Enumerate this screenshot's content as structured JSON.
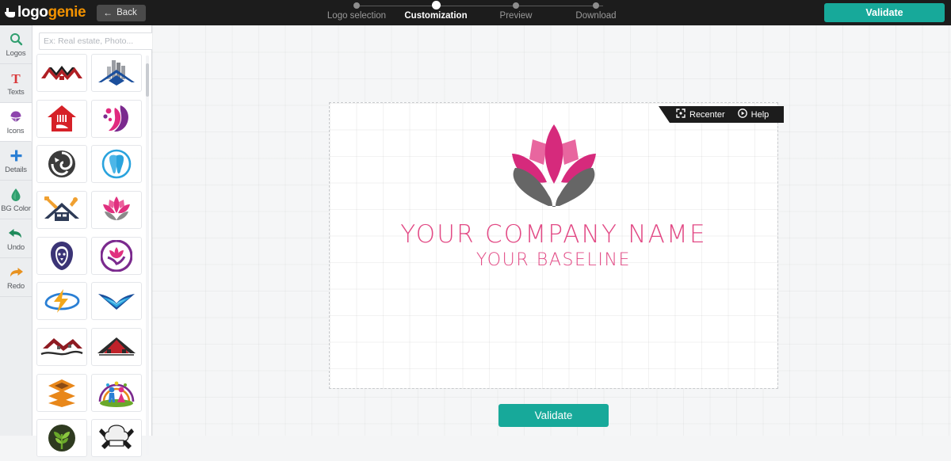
{
  "brand": {
    "part1": "logo",
    "part2": "genie",
    "icon": "lamp-icon"
  },
  "topbar": {
    "back_label": "Back",
    "back_icon": "arrow-left-icon",
    "validate_label": "Validate"
  },
  "steps": [
    {
      "label": "Logo selection",
      "active": false
    },
    {
      "label": "Customization",
      "active": true
    },
    {
      "label": "Preview",
      "active": false
    },
    {
      "label": "Download",
      "active": false
    }
  ],
  "rail": [
    {
      "label": "Logos",
      "icon": "search-icon",
      "color": "#2f9e6e",
      "selected": false
    },
    {
      "label": "Texts",
      "icon": "text-t-icon",
      "color": "#d9383a",
      "selected": false
    },
    {
      "label": "Icons",
      "icon": "shapes-icon",
      "color": "#8e44ad",
      "selected": true
    },
    {
      "label": "Details",
      "icon": "plus-icon",
      "color": "#2a7fd4",
      "selected": false
    },
    {
      "label": "BG Color",
      "icon": "droplet-icon",
      "color": "#2f9e6e",
      "selected": false
    },
    {
      "label": "Undo",
      "icon": "undo-arrow-icon",
      "color": "#1f8a5b",
      "selected": false
    },
    {
      "label": "Redo",
      "icon": "redo-arrow-icon",
      "color": "#e8921f",
      "selected": false
    }
  ],
  "search": {
    "placeholder": "Ex: Real estate, Photo...",
    "value": "",
    "button_icon": "search-icon"
  },
  "thumbnails": [
    {
      "name": "roof-peaks-logo",
      "primary": "#b01f24",
      "secondary": "#1c1c1c"
    },
    {
      "name": "city-buildings-logo",
      "primary": "#1b4f9c",
      "secondary": "#8d9096"
    },
    {
      "name": "red-house-logo",
      "primary": "#d62128",
      "secondary": "#ffffff"
    },
    {
      "name": "hair-flower-logo",
      "primary": "#e02a7f",
      "secondary": "#7b2a8e"
    },
    {
      "name": "dragon-swirl-logo",
      "primary": "#3b3b3b",
      "secondary": "#6d6d6d"
    },
    {
      "name": "tooth-dental-logo",
      "primary": "#2aa3dd",
      "secondary": "#7fcdf0"
    },
    {
      "name": "roof-tools-logo",
      "primary": "#2d3a56",
      "secondary": "#f0a030"
    },
    {
      "name": "lotus-pink-logo",
      "primary": "#e0307f",
      "secondary": "#8a8a8a"
    },
    {
      "name": "lion-head-logo",
      "primary": "#3b3476",
      "secondary": "#5d56a0"
    },
    {
      "name": "lotus-circle-logo",
      "primary": "#e0307f",
      "secondary": "#7b2a8e"
    },
    {
      "name": "lightning-bolt-logo",
      "primary": "#f2a71b",
      "secondary": "#2a7fd4"
    },
    {
      "name": "wings-blue-logo",
      "primary": "#2aa3dd",
      "secondary": "#1b4f9c"
    },
    {
      "name": "red-roof-wave-logo",
      "primary": "#8e1b22",
      "secondary": "#3b3b3b"
    },
    {
      "name": "house-roof-red-logo",
      "primary": "#c0222a",
      "secondary": "#2b2b2b"
    },
    {
      "name": "stacked-layers-logo",
      "primary": "#e8871a",
      "secondary": "#8a4b14"
    },
    {
      "name": "family-people-logo",
      "primary": "#2a7fd4",
      "secondary": "#e0307f"
    },
    {
      "name": "green-tree-logo",
      "primary": "#4b7a1e",
      "secondary": "#2f3b20"
    },
    {
      "name": "chef-hat-knives-logo",
      "primary": "#1c1c1c",
      "secondary": "#e4e4e4"
    }
  ],
  "canvas_toolbar": {
    "recenter_label": "Recenter",
    "recenter_icon": "recenter-frame-icon",
    "help_label": "Help",
    "help_icon": "play-circle-icon"
  },
  "logo": {
    "mark_name": "lotus-hands-logo-mark",
    "company_name": "YOUR COMPANY NAME",
    "baseline": "YOUR BASELINE",
    "text_color": "#e24a85",
    "petal_color": "#d62a7c",
    "petal_light": "#e8669f",
    "hands_color": "#666666"
  },
  "footer": {
    "validate_label": "Validate"
  },
  "colors": {
    "accent_teal": "#17a99a",
    "brand_orange": "#f39200",
    "topbar_bg": "#1c1c1c",
    "pink": "#e24a85"
  }
}
